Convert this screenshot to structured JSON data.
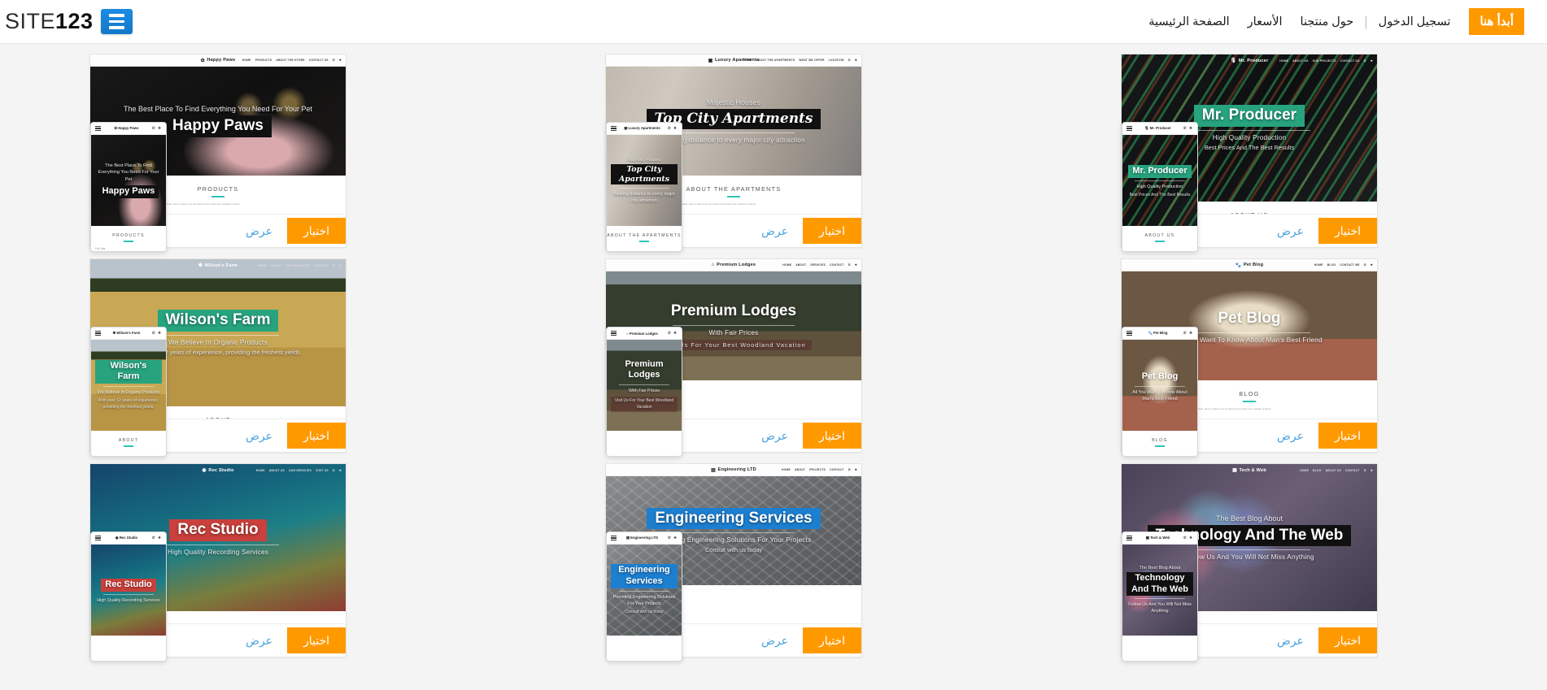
{
  "header": {
    "cta_label": "أبدأ هنا",
    "nav": [
      {
        "label": "الصفحة الرئيسية"
      },
      {
        "label": "الأسعار"
      },
      {
        "label": "حول منتجنا"
      }
    ],
    "separator": "|",
    "login_label": "تسجيل الدخول",
    "brand": {
      "name_light": "SITE",
      "name_bold": "123",
      "icon": "site123-logo-icon"
    },
    "accent_color": "#ff9900",
    "link_color": "#4aa3df"
  },
  "actions": {
    "select_label": "اختيار",
    "preview_label": "عرض"
  },
  "templates": [
    {
      "id": "happy-paws",
      "site_name": "Happy Paws",
      "logo_glyph": "✿",
      "bg_class": "bg-happypaws",
      "tint": "none",
      "bar_style": "light",
      "nav_items": [
        "HOME",
        "PRODUCTS",
        "ABOUT THE STORE",
        "CONTACT US"
      ],
      "hero": {
        "sup": "The Best Place To Find Everything You Need For Your Pet",
        "title": "Happy Paws",
        "title_box": "box-black",
        "sub": "",
        "sub2": ""
      },
      "mobile_hero": {
        "sup": "The Best Place To Find Everything You Need For Your Pet",
        "title": "Happy Paws",
        "title_box": "box-black"
      },
      "section": {
        "title": "PRODUCTS",
        "note": "For Cats"
      }
    },
    {
      "id": "luxury-apartments",
      "site_name": "Luxury Apartments",
      "logo_glyph": "▣",
      "bg_class": "bg-apartments",
      "tint": "soft",
      "bar_style": "light",
      "nav_items": [
        "HOME",
        "ABOUT THE APARTMENTS",
        "WHAT WE OFFER",
        "LOCATION"
      ],
      "hero": {
        "sup": "Majestic Houses",
        "title": "Top City Apartments",
        "title_box": "box-black",
        "title_font": "script",
        "sub": "Walking distance to every major city attraction",
        "sub2": ""
      },
      "mobile_hero": {
        "sup": "Majestic Houses",
        "title": "Top City Apartments",
        "title_box": "box-black",
        "title_font": "script",
        "sub": "Walking distance to every major city attraction"
      },
      "section": {
        "title": "ABOUT THE APARTMENTS",
        "note": ""
      }
    },
    {
      "id": "mr-producer",
      "site_name": "Mr. Producer",
      "logo_glyph": "🎙",
      "bg_class": "bg-producer",
      "tint": "none",
      "bar_style": "overlay",
      "nav_items": [
        "HOME",
        "ABOUT US",
        "OUR PROJECTS",
        "CONTACT US"
      ],
      "hero": {
        "sup": "",
        "title": "Mr. Producer",
        "title_box": "box-green",
        "sub": "High Quality Production",
        "sub2": "Best Prices And The Best Results"
      },
      "mobile_hero": {
        "sup": "",
        "title": "Mr. Producer",
        "title_box": "box-green",
        "sub": "High Quality Production",
        "sub2": "Best Prices And The Best Results"
      },
      "section": {
        "title": "ABOUT US",
        "note": ""
      }
    },
    {
      "id": "wilsons-farm",
      "site_name": "Wilson's Farm",
      "logo_glyph": "✾",
      "bg_class": "bg-farm",
      "tint": "none",
      "bar_style": "overlay",
      "nav_items": [
        "HOME",
        "ABOUT",
        "OUR PRODUCTS",
        "CONTACT"
      ],
      "hero": {
        "sup": "",
        "title": "Wilson's Farm",
        "title_box": "box-green",
        "sub": "We Believe In Organic Products",
        "sub2": "With over 12 years of experience, providing the freshest yields."
      },
      "mobile_hero": {
        "sup": "",
        "title": "Wilson's Farm",
        "title_box": "box-green",
        "sub": "We Believe In Organic Products",
        "sub2": "With over 12 years of experience, providing the freshest yields."
      },
      "section": {
        "title": "ABOUT",
        "note": ""
      }
    },
    {
      "id": "premium-lodges",
      "site_name": "Premium Lodges",
      "logo_glyph": "⌂",
      "bg_class": "bg-lodge",
      "tint": "soft",
      "bar_style": "light",
      "nav_items": [
        "HOME",
        "ABOUT",
        "SERVICES",
        "CONTACT"
      ],
      "hero": {
        "sup": "",
        "title": "Premium Lodges",
        "title_box": "plain",
        "sub": "With Fair Prices",
        "sub2": "Visit Us For Your Best Woodland Vacation",
        "sub2_pill": true
      },
      "mobile_hero": {
        "sup": "",
        "title": "Premium Lodges",
        "title_box": "plain",
        "sub": "With Fair Prices",
        "sub2": "Visit Us For Your Best Woodland Vacation",
        "sub2_pill": true
      },
      "section": {
        "title": "",
        "note": ""
      }
    },
    {
      "id": "pet-blog",
      "site_name": "Pet Blog",
      "logo_glyph": "🐾",
      "bg_class": "bg-petblog",
      "tint": "none",
      "bar_style": "light",
      "nav_items": [
        "HOME",
        "BLOG",
        "CONTACT ME"
      ],
      "hero": {
        "sup": "",
        "title": "Pet Blog",
        "title_box": "plain",
        "sub": "All You Want To Know About Man's Best Friend",
        "sub2": ""
      },
      "mobile_hero": {
        "sup": "",
        "title": "Pet Blog",
        "title_box": "plain",
        "sub": "All You Want To Know About Man's Best Friend"
      },
      "section": {
        "title": "BLOG",
        "note": ""
      }
    },
    {
      "id": "rec-studio",
      "site_name": "Rec Studio",
      "logo_glyph": "◉",
      "bg_class": "bg-recstudio",
      "tint": "none",
      "bar_style": "overlay",
      "nav_items": [
        "HOME",
        "ABOUT US",
        "OUR SERVICES",
        "VISIT US"
      ],
      "hero": {
        "sup": "",
        "title": "Rec Studio",
        "title_box": "box-red",
        "sub": "High Quality Recording Services",
        "sub2": ""
      },
      "mobile_hero": {
        "sup": "",
        "title": "Rec Studio",
        "title_box": "box-red",
        "sub": "High Quality Recording Services"
      },
      "section": {
        "title": "",
        "note": ""
      }
    },
    {
      "id": "engineering-ltd",
      "site_name": "Engineering LTD",
      "logo_glyph": "▤",
      "bg_class": "bg-engineering",
      "tint": "soft",
      "bar_style": "light",
      "nav_items": [
        "HOME",
        "ABOUT",
        "PROJECTS",
        "CONTACT"
      ],
      "hero": {
        "sup": "",
        "title": "Engineering Services",
        "title_box": "box-blue",
        "sub": "Providing Engineering Solutions For Your Projects",
        "sub2": "Consult with us today"
      },
      "mobile_hero": {
        "sup": "",
        "title": "Engineering Services",
        "title_box": "box-blue",
        "sub": "Providing Engineering Solutions For Your Projects",
        "sub2": "Consult with us today"
      },
      "section": {
        "title": "",
        "note": ""
      }
    },
    {
      "id": "tech-and-web",
      "site_name": "Tech & Web",
      "logo_glyph": "▦",
      "bg_class": "bg-techweb",
      "tint": "none",
      "bar_style": "overlay",
      "nav_items": [
        "HOME",
        "BLOG",
        "ABOUT US",
        "CONTACT"
      ],
      "hero": {
        "sup": "The Best Blog About",
        "title": "Technology And The Web",
        "title_box": "box-black",
        "sub": "Follow Us And You Will Not Miss Anything",
        "sub2": ""
      },
      "mobile_hero": {
        "sup": "The Best Blog About",
        "title": "Technology And The Web",
        "title_box": "box-black",
        "sub": "Follow Us And You Will Not Miss Anything"
      },
      "section": {
        "title": "",
        "note": ""
      }
    }
  ]
}
